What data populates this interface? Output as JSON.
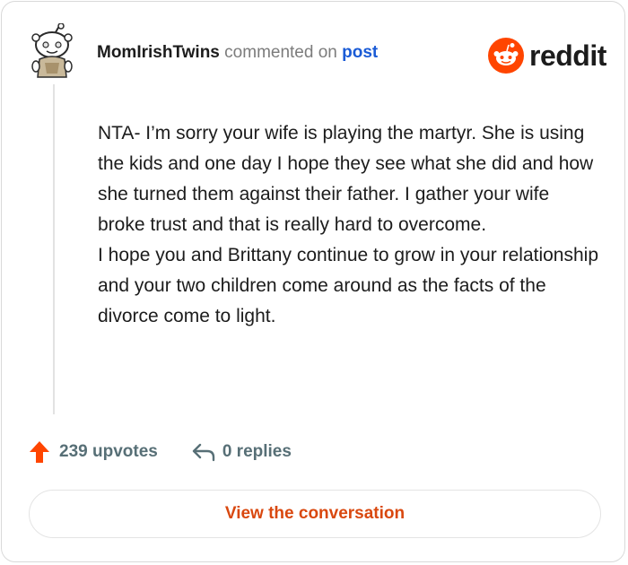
{
  "comment": {
    "username": "MomIrishTwins",
    "action_text": "commented on",
    "post_link_text": "post",
    "paragraphs": [
      "NTA- I’m sorry your wife is playing the martyr. She is using the kids and one day I hope they see what she did and how she turned them against their father. I gather your wife broke trust and that is really hard to overcome.",
      "I hope you and Brittany continue to grow in your relationship and your two children come around as the facts of the divorce come to light."
    ]
  },
  "brand": {
    "name": "reddit",
    "icon": "reddit-snoo-icon",
    "color": "#ff4500"
  },
  "stats": {
    "upvotes_label": "239 upvotes",
    "upvote_icon": "upvote-arrow-icon",
    "upvote_color": "#ff4500",
    "replies_label": "0 replies",
    "reply_icon": "reply-arrow-icon"
  },
  "cta": {
    "label": "View the conversation",
    "color": "#d9480f"
  },
  "avatar": {
    "icon": "snoo-avatar-icon"
  }
}
